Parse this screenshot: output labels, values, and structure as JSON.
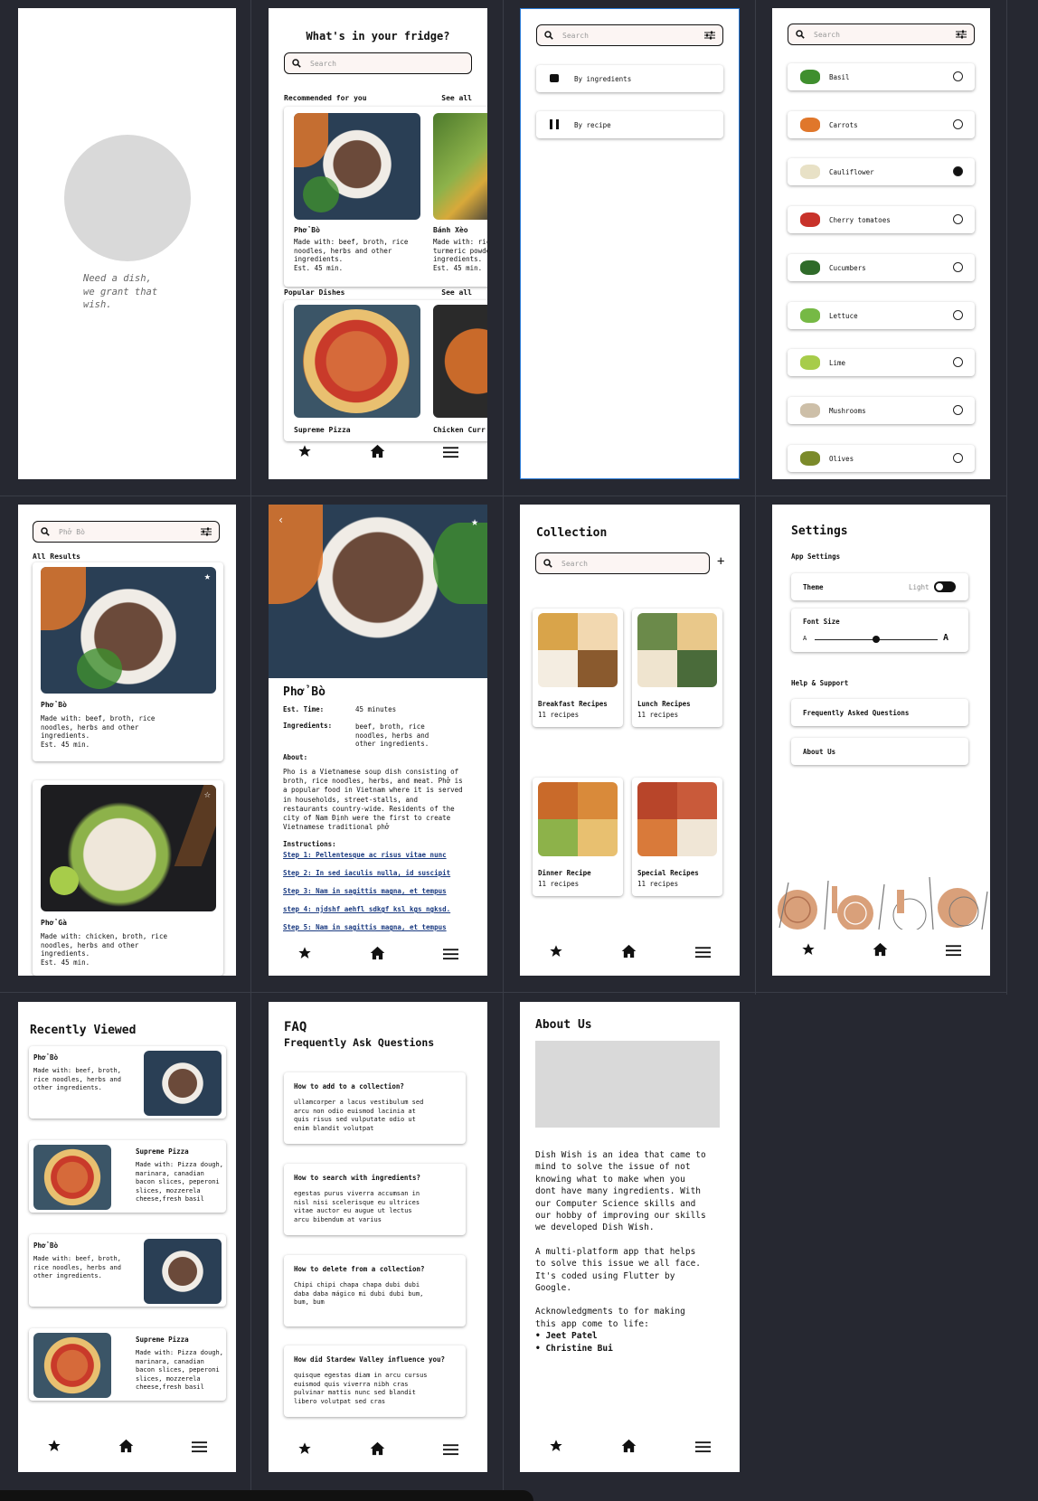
{
  "splash": {
    "tagline_lines": [
      "Need a dish,",
      "we grant that",
      "wish."
    ]
  },
  "home": {
    "title": "What's in your fridge?",
    "search_placeholder": "Search",
    "recommended": {
      "header": "Recommended for you",
      "see_all": "See all",
      "cards": [
        {
          "name": "Phở Bò",
          "lines": [
            "Made with: beef, broth, rice",
            "noodles, herbs and other",
            "ingredients.",
            "Est. 45 min."
          ]
        },
        {
          "name": "Bánh Xèo",
          "lines": [
            "Made with: rice",
            "turmeric powde",
            "ingredients.",
            "Est. 45 min."
          ]
        }
      ]
    },
    "popular": {
      "header": "Popular Dishes",
      "see_all": "See all",
      "cards": [
        {
          "name": "Supreme Pizza"
        },
        {
          "name": "Chicken Curr"
        }
      ]
    }
  },
  "search_mode": {
    "placeholder": "Search",
    "options": [
      {
        "label": "By ingredients"
      },
      {
        "label": "By recipe"
      }
    ]
  },
  "ingredients": {
    "placeholder": "Search",
    "items": [
      {
        "name": "Basil",
        "selected": false,
        "color": "#3f8f2e"
      },
      {
        "name": "Carrots",
        "selected": false,
        "color": "#e0772b"
      },
      {
        "name": "Cauliflower",
        "selected": true,
        "color": "#e8e1c6"
      },
      {
        "name": "Cherry tomatoes",
        "selected": false,
        "color": "#c8322a"
      },
      {
        "name": "Cucumbers",
        "selected": false,
        "color": "#2f6b2a"
      },
      {
        "name": "Lettuce",
        "selected": false,
        "color": "#76b945"
      },
      {
        "name": "Lime",
        "selected": false,
        "color": "#a7cc4a"
      },
      {
        "name": "Mushrooms",
        "selected": false,
        "color": "#cdbfa8"
      },
      {
        "name": "Olives",
        "selected": false,
        "color": "#7b8a2a"
      }
    ]
  },
  "results": {
    "query": "Phở Bò",
    "header": "All Results",
    "items": [
      {
        "name": "Phở Bò",
        "lines": [
          "Made with: beef, broth, rice",
          "noodles, herbs and other",
          "ingredients.",
          "Est. 45 min."
        ]
      },
      {
        "name": "Phở Gà",
        "lines": [
          "Made with: chicken, broth, rice",
          "noodles, herbs and other",
          "ingredients.",
          "Est. 45 min."
        ]
      }
    ]
  },
  "detail": {
    "title": "Phở Bò",
    "est_label": "Est. Time:",
    "est_value": "45 minutes",
    "ingredients_label": "Ingredients:",
    "ingredients_lines": [
      "beef, broth, rice",
      "noodles, herbs and",
      "other ingredients."
    ],
    "about_label": "About:",
    "about_lines": [
      "Pho is a Vietnamese soup dish consisting of",
      "broth, rice noodles, herbs, and meat. Phở is",
      "a popular food in Vietnam where it is served",
      "in households, street-stalls, and",
      "restaurants country-wide. Residents of the",
      "city of Nam Định were the first to create",
      "Vietnamese traditional phở"
    ],
    "instructions_label": "Instructions:",
    "steps": [
      "Step 1: Pellentesque ac risus vitae nunc",
      "Step 2: In sed iaculis nulla, id suscipit",
      "Step 3: Nam in sagittis magna, et tempus",
      "step 4: njdshf aehfl sdkgf ksl kgs ngksd.",
      "Step 5: Nam in sagittis magna, et tempus"
    ]
  },
  "collection": {
    "title": "Collection",
    "search_placeholder": "Search",
    "add": "+",
    "items": [
      {
        "name": "Breakfast Recipes",
        "count": "11 recipes"
      },
      {
        "name": "Lunch Recipes",
        "count": "11 recipes"
      },
      {
        "name": "Dinner Recipe",
        "count": "11 recipes"
      },
      {
        "name": "Special Recipes",
        "count": "11 recipes"
      }
    ]
  },
  "settings": {
    "title": "Settings",
    "app_settings": "App Settings",
    "theme_label": "Theme",
    "theme_value": "Light",
    "font_size_label": "Font Size",
    "font_small": "A",
    "font_large": "A",
    "font_level": 0.5,
    "help": "Help & Support",
    "faq_link": "Frequently Asked Questions",
    "about_link": "About Us"
  },
  "recent": {
    "title": "Recently Viewed",
    "items": [
      {
        "name": "Phở Bò",
        "lines": [
          "Made with: beef, broth,",
          "rice noodles, herbs and",
          "other ingredients."
        ],
        "img": "pho"
      },
      {
        "name": "Supreme Pizza",
        "lines": [
          "Made with: Pizza dough,",
          "marinara, canadian",
          "bacon slices, peperoni",
          "slices, mozzerela",
          "cheese,fresh basil"
        ],
        "img": "pizza"
      },
      {
        "name": "Phở Bò",
        "lines": [
          "Made with: beef, broth,",
          "rice noodles, herbs and",
          "other ingredients."
        ],
        "img": "pho"
      },
      {
        "name": "Supreme Pizza",
        "lines": [
          "Made with: Pizza dough,",
          "marinara, canadian",
          "bacon slices, peperoni",
          "slices, mozzerela",
          "cheese,fresh basil"
        ],
        "img": "pizza"
      }
    ]
  },
  "faq": {
    "title": "FAQ",
    "subtitle": "Frequently Ask Questions",
    "items": [
      {
        "q": "How to add to a collection?",
        "lines": [
          "ullamcorper a lacus vestibulum sed",
          "arcu non odio euismod lacinia at",
          "quis risus sed vulputate odio ut",
          "enim blandit volutpat"
        ]
      },
      {
        "q": "How to search with ingredients?",
        "lines": [
          "egestas purus viverra accumsan in",
          "nisl nisi scelerisque eu ultrices",
          "vitae auctor eu augue ut lectus",
          "arcu bibendum at varius"
        ]
      },
      {
        "q": "How to delete from a collection?",
        "lines": [
          "Chipi chipi chapa chapa dubi dubi",
          "daba daba mágico mi dubi dubi bum,",
          "bum, bum"
        ]
      },
      {
        "q": "How did Stardew Valley influence you?",
        "lines": [
          "quisque egestas diam in arcu cursus",
          "euismod quis viverra nibh cras",
          "pulvinar mattis nunc sed blandit",
          "libero volutpat sed cras"
        ]
      }
    ]
  },
  "about": {
    "title": "About Us",
    "p1": [
      "Dish Wish is an idea that came to",
      "mind to solve the issue of not",
      "knowing what to make when you",
      "dont have many ingredients. With",
      "our Computer Science skills and",
      "our hobby of improving our skills",
      "we developed Dish Wish."
    ],
    "p2": [
      "A multi-platform app that helps",
      "to solve this issue we all face.",
      "It's coded using Flutter by",
      "Google."
    ],
    "p3": [
      "Acknowledgments to for making",
      "this app come to life:"
    ],
    "credits": [
      "• Jeet Patel",
      "• Christine Bui"
    ]
  },
  "nav_icons": [
    "star-icon",
    "home-icon",
    "menu-icon"
  ],
  "colors": {
    "background": "#262831",
    "search_fill": "#fcf5f3",
    "link": "#1a3a80",
    "underline": "#2a7ad6"
  }
}
